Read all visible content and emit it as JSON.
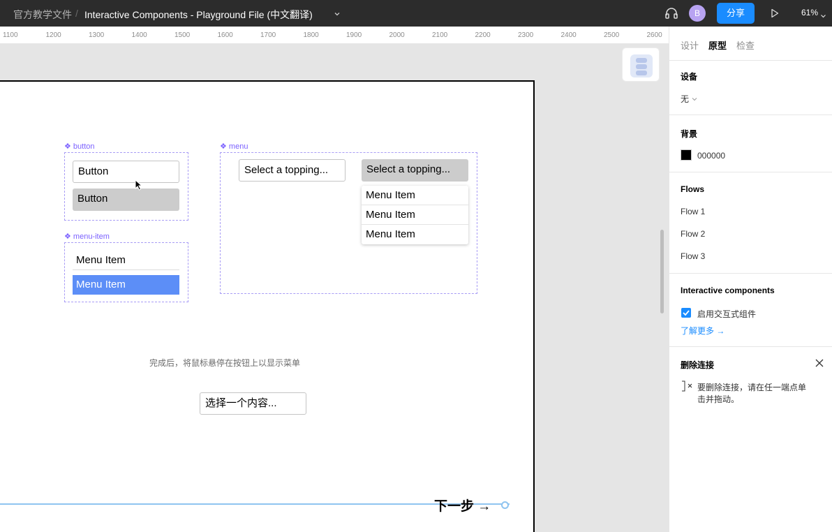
{
  "topbar": {
    "project": "官方教学文件",
    "separator": "/",
    "file_name": "Interactive Components - Playground File (中文翻译)",
    "avatar_initial": "B",
    "share_label": "分享",
    "zoom_level": "61%"
  },
  "ruler": {
    "ticks": [
      "1100",
      "1200",
      "1300",
      "1400",
      "1500",
      "1600",
      "1700",
      "1800",
      "1900",
      "2000",
      "2100",
      "2200",
      "2300",
      "2400",
      "2500",
      "2600"
    ]
  },
  "canvas": {
    "button_component_label": "❖ button",
    "button_default": "Button",
    "button_hover": "Button",
    "menu_component_label": "❖ menu",
    "menu_select_default": "Select a topping...",
    "menu_select_open": "Select a topping...",
    "menu_items": [
      "Menu Item",
      "Menu Item",
      "Menu Item"
    ],
    "menu_item_component_label": "❖ menu-item",
    "menu_item_default": "Menu Item",
    "menu_item_selected": "Menu Item",
    "hint_text": "完成后，将鼠标悬停在按钮上以显示菜单",
    "select_content": "选择一个内容...",
    "next_label": "下一步 →"
  },
  "panel": {
    "tabs": [
      "设计",
      "原型",
      "检查"
    ],
    "active_tab": "原型",
    "device_title": "设备",
    "device_value": "无",
    "background_title": "背景",
    "background_hex": "000000",
    "flows_title": "Flows",
    "flows": [
      "Flow 1",
      "Flow 2",
      "Flow 3"
    ],
    "ic_title": "Interactive components",
    "ic_checkbox_label": "启用交互式组件",
    "ic_learn_more": "了解更多 →",
    "remove_title": "删除连接",
    "remove_hint_line1": "要删除连接，请在任一端点单",
    "remove_hint_line2": "击并拖动。"
  },
  "colors": {
    "accent": "#1a8cff",
    "component_purple": "#7b61ff",
    "selected_item": "#5c8ef7",
    "connector": "#8fc4f0"
  }
}
